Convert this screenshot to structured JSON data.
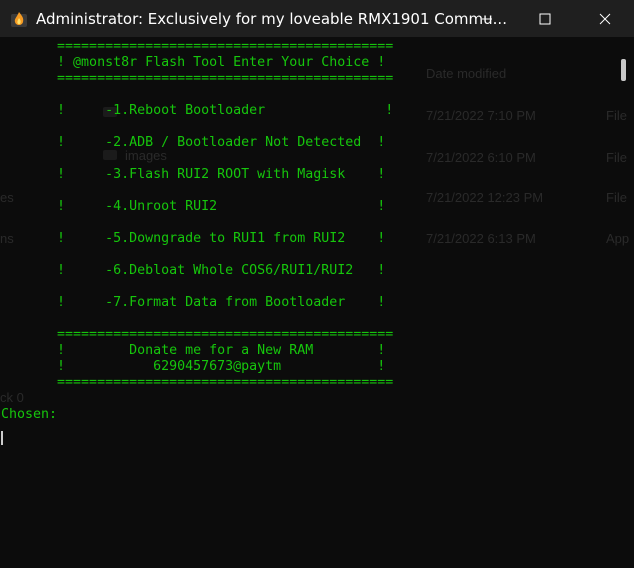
{
  "window": {
    "title": "Administrator:  Exclusively for my loveable RMX1901 Commu...",
    "icon": "terminal-fire-icon"
  },
  "console": {
    "lines": [
      "       ==========================================",
      "       ! @monst8r Flash Tool Enter Your Choice !",
      "       ==========================================",
      "       !     -1.Reboot Bootloader               !",
      "       !     -2.ADB / Bootloader Not Detected  !",
      "       !     -3.Flash RUI2 ROOT with Magisk    !",
      "       !     -4.Unroot RUI2                    !",
      "       !     -5.Downgrade to RUI1 from RUI2    !",
      "       !     -6.Debloat Whole COS6/RUI1/RUI2   !",
      "       !     -7.Format Data from Bootloader    !",
      "       ==========================================",
      "       !        Donate me for a New RAM        !",
      "       !           6290457673@paytm            !",
      "       ==========================================",
      "Chosen:"
    ]
  },
  "background_ghost": {
    "header": "Date modified",
    "folder": "images",
    "dates": [
      "7/21/2022 7:10 PM",
      "7/21/2022 6:10 PM",
      "7/21/2022 12:23 PM",
      "7/21/2022 6:13 PM"
    ],
    "types": [
      "File",
      "File",
      "File",
      "App"
    ],
    "left_fragments": [
      "es",
      "ns",
      "ck 0"
    ]
  },
  "colors": {
    "terminal_text": "#16c60c",
    "background": "#0c0c0c",
    "titlebar": "#1f1f1f"
  }
}
